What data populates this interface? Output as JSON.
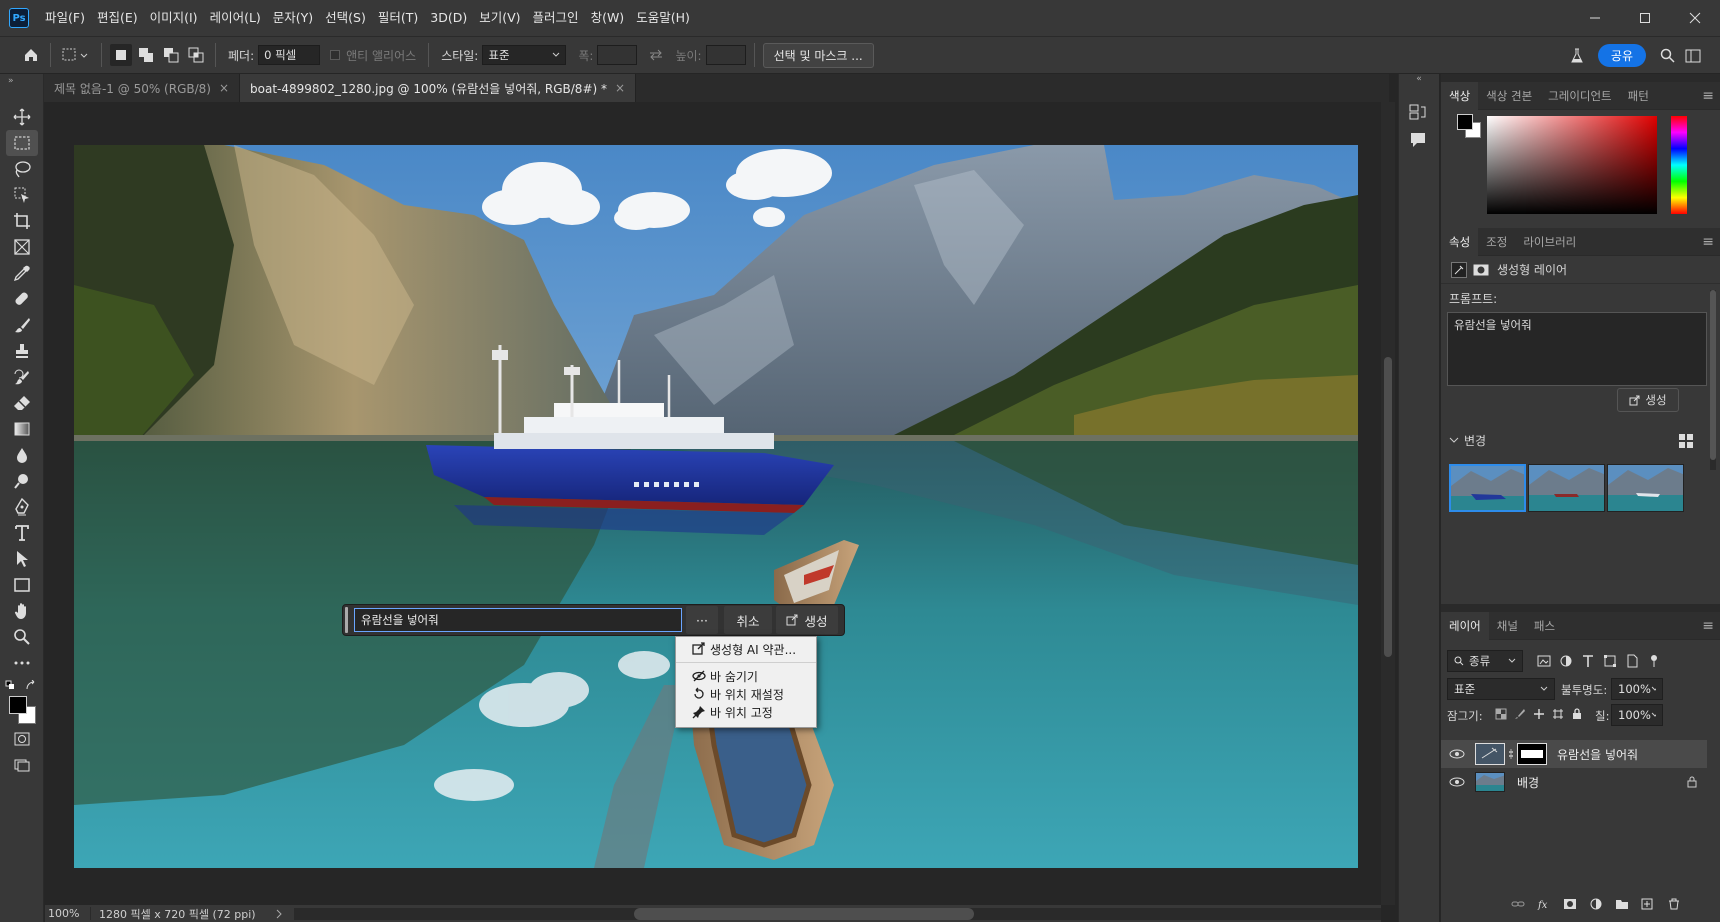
{
  "app": {
    "logo": "Ps"
  },
  "menubar": {
    "items": [
      "파일(F)",
      "편집(E)",
      "이미지(I)",
      "레이어(L)",
      "문자(Y)",
      "선택(S)",
      "필터(T)",
      "3D(D)",
      "보기(V)",
      "플러그인",
      "창(W)",
      "도움말(H)"
    ]
  },
  "options": {
    "feather_label": "페더:",
    "feather_value": "0 픽셀",
    "antialias_label": "앤티 앨리어스",
    "style_label": "스타일:",
    "style_value": "표준",
    "width_label": "폭:",
    "height_label": "높이:",
    "select_mask_label": "선택 및 마스크 ...",
    "share_label": "공유"
  },
  "tabs": [
    {
      "label": "제목 없음-1 @ 50% (RGB/8)",
      "active": false
    },
    {
      "label": "boat-4899802_1280.jpg @ 100% (유람선을 넣어줘, RGB/8#) *",
      "active": true
    }
  ],
  "prompt_bar": {
    "value": "유람선을 넣어줘",
    "more_label": "···",
    "cancel_label": "취소",
    "generate_label": "생성"
  },
  "context_menu": {
    "items": [
      "생성형 AI 약관...",
      "바 숨기기",
      "바 위치 재설정",
      "바 위치 고정"
    ]
  },
  "status": {
    "zoom": "100%",
    "doc_info": "1280 픽셀 x 720 픽셀 (72 ppi)"
  },
  "color_panel": {
    "tabs": [
      "색상",
      "색상 견본",
      "그레이디언트",
      "패턴"
    ]
  },
  "properties_panel": {
    "tabs": [
      "속성",
      "조정",
      "라이브러리"
    ],
    "layer_type": "생성형 레이어",
    "prompt_label": "프롬프트:",
    "prompt_value": "유람선을 넣어줘",
    "generate_label": "생성",
    "variations_label": "변경"
  },
  "layers_panel": {
    "tabs": [
      "레이어",
      "채널",
      "패스"
    ],
    "filter_kind": "종류",
    "blend_mode": "표준",
    "opacity_label": "불투명도:",
    "opacity_value": "100%",
    "lock_label": "잠그기:",
    "fill_label": "칠:",
    "fill_value": "100%",
    "layers": [
      {
        "name": "유람선을 넣어줘",
        "selected": true
      },
      {
        "name": "배경",
        "selected": false
      }
    ]
  },
  "colors": {
    "accent": "#1473e6",
    "selection": "#31a8ff"
  }
}
